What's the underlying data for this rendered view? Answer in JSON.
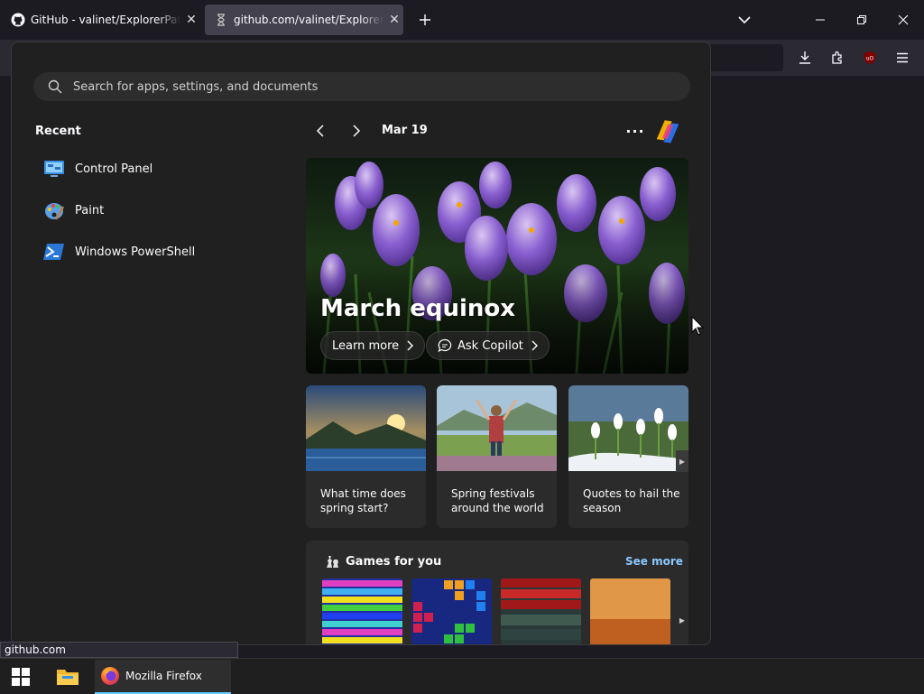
{
  "browser": {
    "tabs": [
      {
        "label": "GitHub - valinet/ExplorerPatcher",
        "favicon": "github-icon"
      },
      {
        "label": "github.com/valinet/ExplorerPatcher",
        "favicon": "hourglass-icon"
      }
    ],
    "new_tab_icon": "plus-icon",
    "list_tabs_icon": "chevron-down-icon",
    "window_controls": [
      "minimize-icon",
      "restore-icon",
      "close-icon"
    ],
    "toolbar_icons": [
      "download-icon",
      "extensions-icon",
      "ublock-icon",
      "menu-icon"
    ],
    "status_text": "github.com"
  },
  "start_menu": {
    "search": {
      "placeholder": "Search for apps, settings, and documents"
    },
    "recent": {
      "heading": "Recent",
      "items": [
        {
          "label": "Control Panel",
          "icon": "control-panel-icon"
        },
        {
          "label": "Paint",
          "icon": "paint-icon"
        },
        {
          "label": "Windows PowerShell",
          "icon": "powershell-icon"
        }
      ]
    },
    "feed": {
      "date": "Mar 19",
      "hero": {
        "title": "March equinox",
        "learn_more": "Learn more",
        "ask_copilot": "Ask Copilot"
      },
      "cards": [
        {
          "title": "What time does spring start?"
        },
        {
          "title": "Spring festivals around the world"
        },
        {
          "title": "Quotes to hail the season"
        }
      ],
      "games": {
        "title": "Games for you",
        "see_more": "See more"
      }
    }
  },
  "taskbar": {
    "firefox_label": "Mozilla Firefox"
  },
  "colors": {
    "accent": "#60cdff",
    "link": "#8ac9ff",
    "menu_bg": "#202020",
    "card_bg": "#2b2b2b"
  }
}
